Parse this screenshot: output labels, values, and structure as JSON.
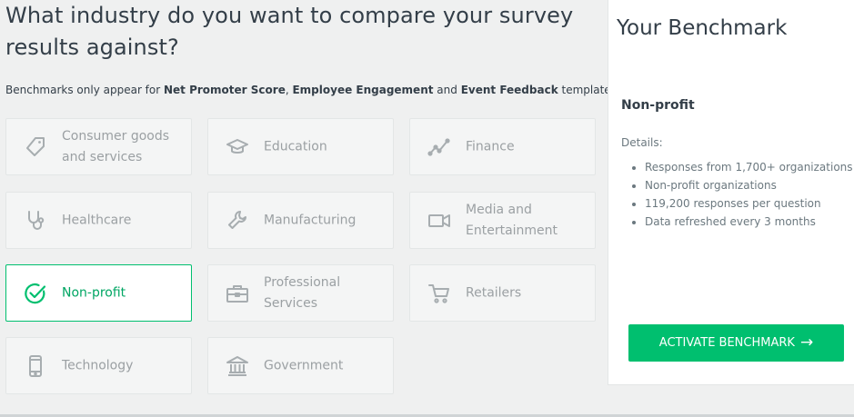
{
  "header": {
    "title": "What industry do you want to compare your survey results against?",
    "subtitle_prefix": "Benchmarks only appear for ",
    "subtitle_bold_1": "Net Promoter Score",
    "subtitle_sep_1": ", ",
    "subtitle_bold_2": "Employee Engagement",
    "subtitle_sep_2": " and ",
    "subtitle_bold_3": "Event Feedback",
    "subtitle_suffix": " templates."
  },
  "industries": [
    {
      "label": "Consumer goods and services",
      "icon": "tag-icon"
    },
    {
      "label": "Education",
      "icon": "graduation-cap-icon"
    },
    {
      "label": "Finance",
      "icon": "line-chart-icon"
    },
    {
      "label": "Healthcare",
      "icon": "stethoscope-icon"
    },
    {
      "label": "Manufacturing",
      "icon": "wrench-icon"
    },
    {
      "label": "Media and Entertainment",
      "icon": "video-camera-icon"
    },
    {
      "label": "Non-profit",
      "icon": "check-circle-icon",
      "selected": true
    },
    {
      "label": "Professional Services",
      "icon": "briefcase-icon"
    },
    {
      "label": "Retailers",
      "icon": "shopping-cart-icon"
    },
    {
      "label": "Technology",
      "icon": "mobile-phone-icon"
    },
    {
      "label": "Government",
      "icon": "bank-building-icon"
    }
  ],
  "panel": {
    "title": "Your Benchmark",
    "industry": "Non-profit",
    "details_label": "Details:",
    "details": [
      "Responses from 1,700+ organizations",
      "Non-profit organizations",
      "119,200 responses per question",
      "Data refreshed every 3 months"
    ],
    "button_label": "ACTIVATE BENCHMARK",
    "button_icon": "arrow-right-icon"
  },
  "colors": {
    "accent": "#00bf6f",
    "selected_text": "#00a663",
    "muted_text": "#9ba0a3",
    "icon_gray": "#a7adb0",
    "background": "#eff0f0"
  }
}
